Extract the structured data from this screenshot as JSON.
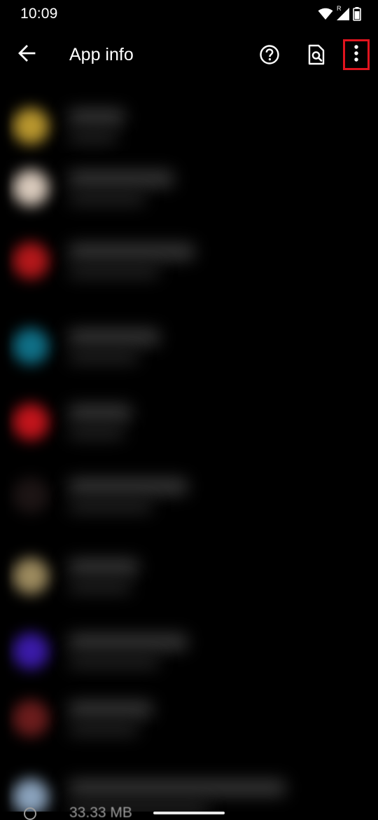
{
  "status_bar": {
    "time": "10:09",
    "wifi_icon": "wifi-icon",
    "signal_icon": "cell-signal-icon",
    "roaming_indicator": "R",
    "battery_icon": "battery-icon"
  },
  "app_bar": {
    "title": "App info",
    "back_icon": "arrow-back-icon",
    "help_icon": "help-circle-icon",
    "search_icon": "search-document-icon",
    "more_icon": "more-vertical-icon",
    "highlight_color": "#e0141e"
  },
  "app_list": {
    "rows": [
      {
        "icon_color": "#b8962e"
      },
      {
        "icon_color": "#d8c9bb"
      },
      {
        "icon_color": "#b3171a"
      },
      {
        "icon_color": "#0f6f86"
      },
      {
        "icon_color": "#c2141b"
      },
      {
        "icon_color": "#1c1414"
      },
      {
        "icon_color": "#9c8a5e"
      },
      {
        "icon_color": "#3a1aa8"
      },
      {
        "icon_color": "#6b1c1c"
      },
      {
        "icon_color": "#8aa2bc"
      }
    ],
    "partial_row_size": "33.33 MB"
  }
}
